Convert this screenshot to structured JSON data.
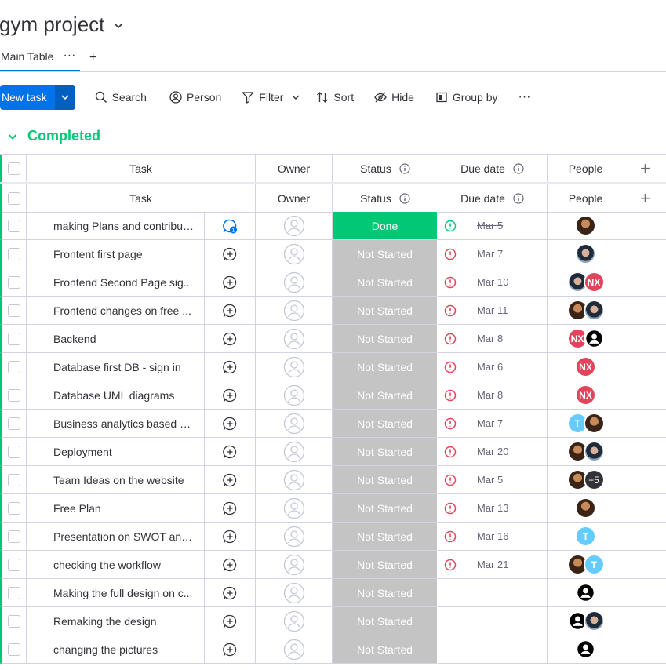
{
  "board": {
    "title": "gym project"
  },
  "views": {
    "main_tab": "Main Table",
    "more": "···",
    "add": "+"
  },
  "toolbar": {
    "new_task": "New task",
    "search": "Search",
    "person": "Person",
    "filter": "Filter",
    "sort": "Sort",
    "hide": "Hide",
    "group_by": "Group by",
    "more": "···"
  },
  "group": {
    "title": "Completed",
    "color": "#00c875"
  },
  "columns": {
    "task": "Task",
    "owner": "Owner",
    "status": "Status",
    "due_date": "Due date",
    "people": "People",
    "add": "+"
  },
  "colors": {
    "done": "#00c875",
    "not_started": "#c4c4c4",
    "overdue": "#e2445c",
    "primary": "#0073ea"
  },
  "rows": [
    {
      "task": "making Plans and contribut...",
      "updates": "1",
      "status": "Done",
      "due": "Mar 5",
      "people": [
        "photo1"
      ]
    },
    {
      "task": "Frontent first page",
      "status": "Not Started",
      "due": "Mar 7",
      "people": [
        "photo2"
      ]
    },
    {
      "task": "Frontend Second Page sig...",
      "status": "Not Started",
      "due": "Mar 10",
      "people": [
        "photo2",
        "NX"
      ]
    },
    {
      "task": "Frontend changes on free ...",
      "status": "Not Started",
      "due": "Mar 11",
      "people": [
        "photo1",
        "photo2"
      ]
    },
    {
      "task": "Backend",
      "status": "Not Started",
      "due": "Mar 8",
      "people": [
        "NX",
        "default"
      ]
    },
    {
      "task": "Database first DB - sign in",
      "status": "Not Started",
      "due": "Mar 6",
      "people": [
        "NX"
      ]
    },
    {
      "task": "Database UML diagrams",
      "status": "Not Started",
      "due": "Mar 8",
      "people": [
        "NX"
      ]
    },
    {
      "task": "Business analytics based o...",
      "status": "Not Started",
      "due": "Mar 7",
      "people": [
        "T",
        "photo1"
      ]
    },
    {
      "task": "Deployment",
      "status": "Not Started",
      "due": "Mar 20",
      "people": [
        "photo1",
        "photo2"
      ]
    },
    {
      "task": "Team Ideas on the website",
      "status": "Not Started",
      "due": "Mar 5",
      "people": [
        "photo1",
        "+5"
      ]
    },
    {
      "task": "Free Plan",
      "status": "Not Started",
      "due": "Mar 13",
      "people": [
        "photo1"
      ]
    },
    {
      "task": "Presentation on SWOT and...",
      "status": "Not Started",
      "due": "Mar 16",
      "people": [
        "T"
      ]
    },
    {
      "task": "checking the workflow",
      "status": "Not Started",
      "due": "Mar 21",
      "people": [
        "photo1",
        "T"
      ]
    },
    {
      "task": "Making the full design on c...",
      "status": "Not Started",
      "due": "",
      "people": [
        "default"
      ]
    },
    {
      "task": "Remaking the design",
      "status": "Not Started",
      "due": "",
      "people": [
        "default",
        "photo2"
      ]
    },
    {
      "task": "changing the pictures",
      "status": "Not Started",
      "due": "",
      "people": [
        "default"
      ]
    }
  ]
}
